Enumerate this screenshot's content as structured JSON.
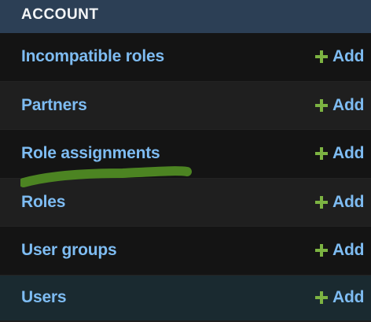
{
  "module": {
    "caption": "ACCOUNT",
    "add_label": "Add",
    "add_icon": "plus-icon",
    "models": [
      {
        "label": "Incompatible roles"
      },
      {
        "label": "Partners"
      },
      {
        "label": "Role assignments"
      },
      {
        "label": "Roles"
      },
      {
        "label": "User groups"
      },
      {
        "label": "Users"
      }
    ]
  },
  "colors": {
    "caption_bg": "#2c3f55",
    "link": "#7ebcf2",
    "add_icon": "#7cb342",
    "annotation": "#4f8a23"
  }
}
